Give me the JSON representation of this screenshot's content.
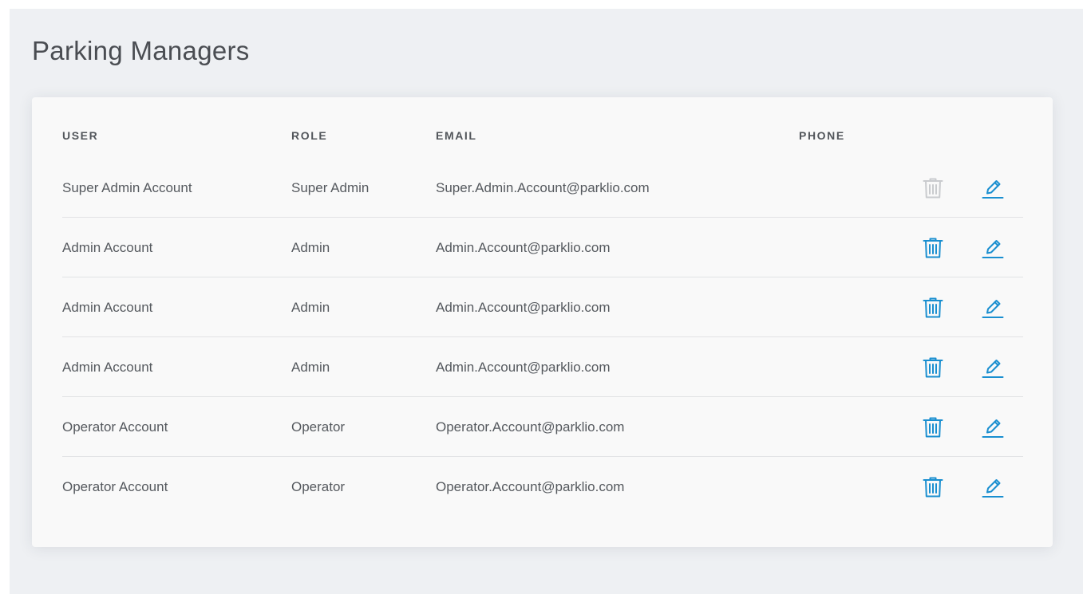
{
  "page": {
    "title": "Parking Managers"
  },
  "colors": {
    "accent": "#1a8fd0",
    "disabled_icon": "#c9cbce",
    "text": "#55595e",
    "header_text": "#52565b"
  },
  "table": {
    "columns": {
      "user": "USER",
      "role": "ROLE",
      "email": "EMAIL",
      "phone": "PHONE"
    },
    "rows": [
      {
        "user": "Super Admin Account",
        "role": "Super Admin",
        "email": "Super.Admin.Account@parklio.com",
        "phone": "",
        "delete_disabled": true
      },
      {
        "user": "Admin Account",
        "role": "Admin",
        "email": "Admin.Account@parklio.com",
        "phone": "",
        "delete_disabled": false
      },
      {
        "user": "Admin Account",
        "role": "Admin",
        "email": "Admin.Account@parklio.com",
        "phone": "",
        "delete_disabled": false
      },
      {
        "user": "Admin Account",
        "role": "Admin",
        "email": "Admin.Account@parklio.com",
        "phone": "",
        "delete_disabled": false
      },
      {
        "user": "Operator Account",
        "role": "Operator",
        "email": "Operator.Account@parklio.com",
        "phone": "",
        "delete_disabled": false
      },
      {
        "user": "Operator Account",
        "role": "Operator",
        "email": "Operator.Account@parklio.com",
        "phone": "",
        "delete_disabled": false
      }
    ],
    "icons": {
      "delete": "trash-icon",
      "edit": "pencil-icon"
    }
  }
}
